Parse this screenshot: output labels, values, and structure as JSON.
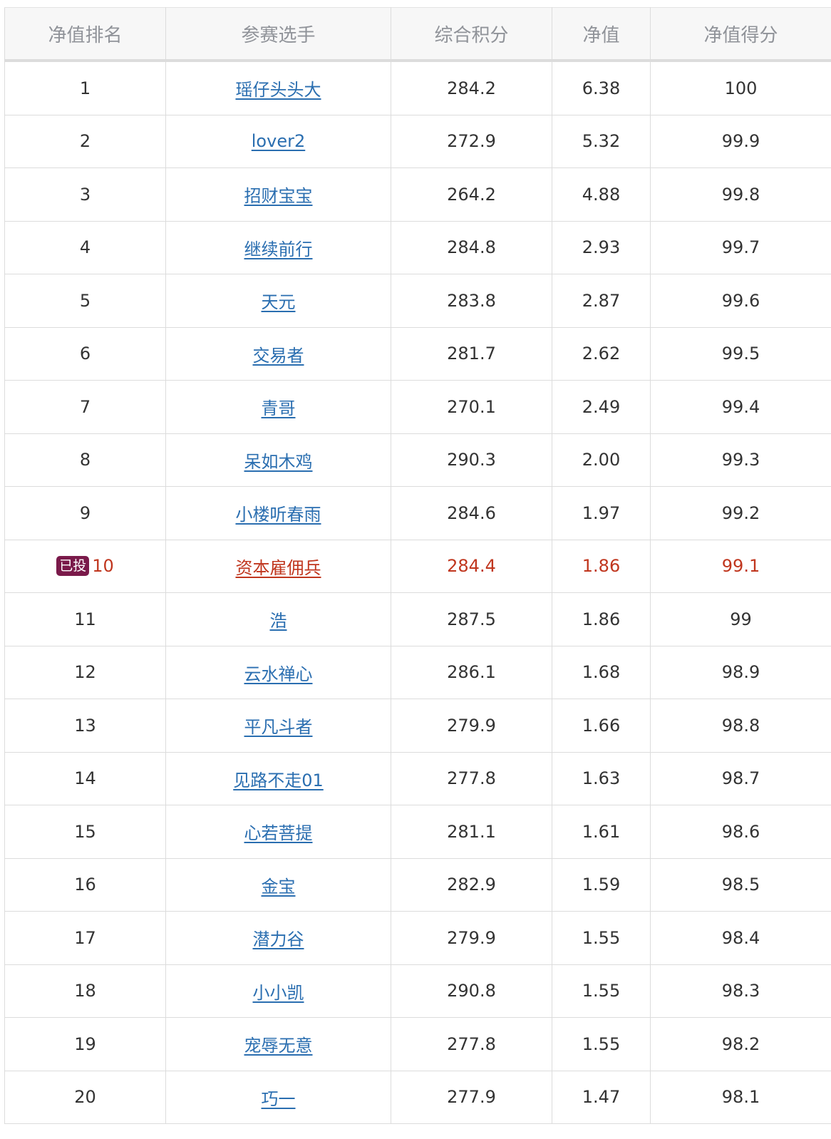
{
  "table": {
    "headers": [
      "净值排名",
      "参赛选手",
      "综合积分",
      "净值",
      "净值得分"
    ],
    "rows": [
      {
        "rank": "1",
        "player": "瑶仔头头大",
        "score": "284.2",
        "nav": "6.38",
        "nav_score": "100"
      },
      {
        "rank": "2",
        "player": "lover2",
        "score": "272.9",
        "nav": "5.32",
        "nav_score": "99.9"
      },
      {
        "rank": "3",
        "player": "招财宝宝",
        "score": "264.2",
        "nav": "4.88",
        "nav_score": "99.8"
      },
      {
        "rank": "4",
        "player": "继续前行",
        "score": "284.8",
        "nav": "2.93",
        "nav_score": "99.7"
      },
      {
        "rank": "5",
        "player": "天元",
        "score": "283.8",
        "nav": "2.87",
        "nav_score": "99.6"
      },
      {
        "rank": "6",
        "player": "交易者",
        "score": "281.7",
        "nav": "2.62",
        "nav_score": "99.5"
      },
      {
        "rank": "7",
        "player": "青哥",
        "score": "270.1",
        "nav": "2.49",
        "nav_score": "99.4"
      },
      {
        "rank": "8",
        "player": "呆如木鸡",
        "score": "290.3",
        "nav": "2.00",
        "nav_score": "99.3"
      },
      {
        "rank": "9",
        "player": "小楼听春雨",
        "score": "284.6",
        "nav": "1.97",
        "nav_score": "99.2"
      },
      {
        "rank": "10",
        "badge": "已投",
        "highlight": true,
        "player": "资本雇佣兵",
        "score": "284.4",
        "nav": "1.86",
        "nav_score": "99.1"
      },
      {
        "rank": "11",
        "player": "浩",
        "score": "287.5",
        "nav": "1.86",
        "nav_score": "99"
      },
      {
        "rank": "12",
        "player": "云水禅心",
        "score": "286.1",
        "nav": "1.68",
        "nav_score": "98.9"
      },
      {
        "rank": "13",
        "player": "平凡斗者",
        "score": "279.9",
        "nav": "1.66",
        "nav_score": "98.8"
      },
      {
        "rank": "14",
        "player": "见路不走01",
        "score": "277.8",
        "nav": "1.63",
        "nav_score": "98.7"
      },
      {
        "rank": "15",
        "player": "心若菩提",
        "score": "281.1",
        "nav": "1.61",
        "nav_score": "98.6"
      },
      {
        "rank": "16",
        "player": "金宝",
        "score": "282.9",
        "nav": "1.59",
        "nav_score": "98.5"
      },
      {
        "rank": "17",
        "player": "潜力谷",
        "score": "279.9",
        "nav": "1.55",
        "nav_score": "98.4"
      },
      {
        "rank": "18",
        "player": "小小凯",
        "score": "290.8",
        "nav": "1.55",
        "nav_score": "98.3"
      },
      {
        "rank": "19",
        "player": "宠辱无意",
        "score": "277.8",
        "nav": "1.55",
        "nav_score": "98.2"
      },
      {
        "rank": "20",
        "player": "巧一",
        "score": "277.9",
        "nav": "1.47",
        "nav_score": "98.1"
      }
    ]
  },
  "colors": {
    "link": "#2a6eb0",
    "highlight": "#c0361e",
    "badge_bg": "#7a1a4a",
    "header_bg": "#f7f7f7",
    "header_text": "#909399",
    "border": "#dcdcdc"
  }
}
